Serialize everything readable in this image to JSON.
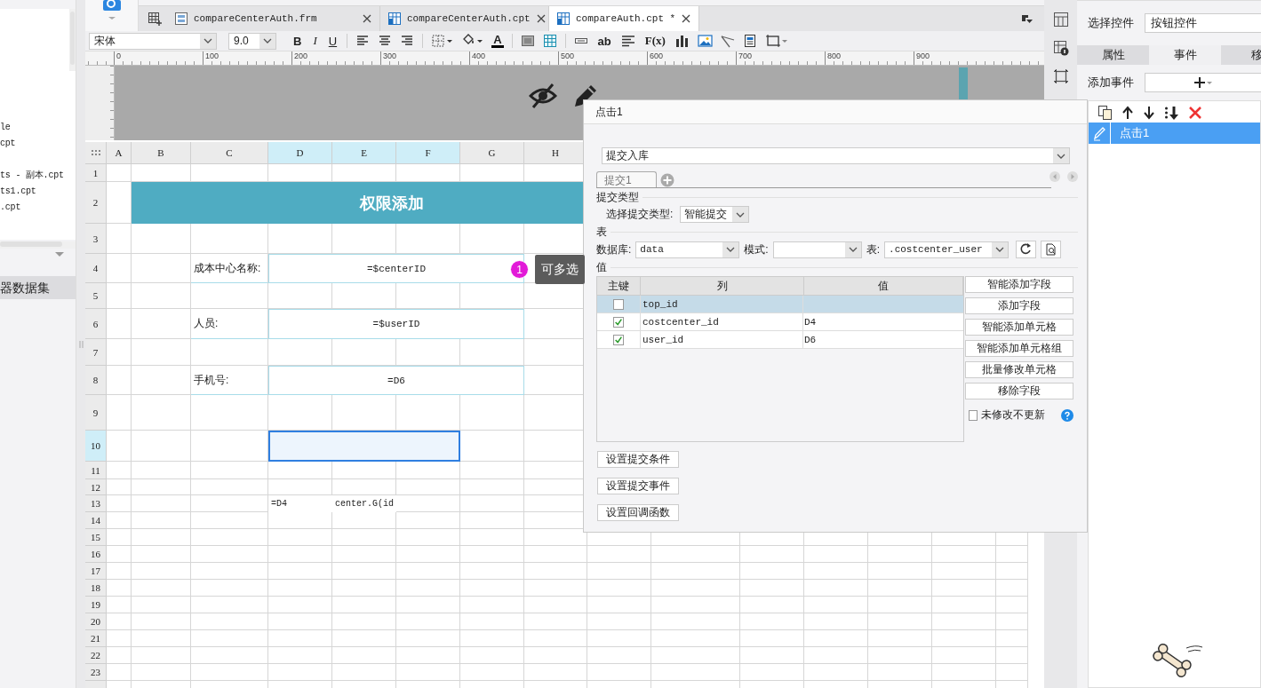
{
  "left_panel": {
    "files": [
      "le",
      "cpt",
      "ts - 副本.cpt",
      "ts1.cpt",
      ".cpt"
    ],
    "section": "器数据集"
  },
  "editor_tabs": [
    {
      "label": "compareCenterAuth.frm",
      "kind": "form",
      "selected": false
    },
    {
      "label": "compareCenterAuth.cpt",
      "kind": "report",
      "selected": false
    },
    {
      "label": "compareAuth.cpt *",
      "kind": "report",
      "selected": true
    }
  ],
  "toolbar": {
    "font": "宋体",
    "font_size": "9.0",
    "bold": "B",
    "italic": "I",
    "underline": "U",
    "font_color": "A",
    "text_tool": "ab",
    "formula": "F(x)"
  },
  "ruler": [
    "0",
    "100",
    "200",
    "300",
    "400",
    "500",
    "600",
    "700",
    "800",
    "900"
  ],
  "sheet": {
    "columns": [
      {
        "label": "A",
        "selected": false
      },
      {
        "label": "B",
        "selected": false
      },
      {
        "label": "C",
        "selected": false
      },
      {
        "label": "D",
        "selected": true
      },
      {
        "label": "E",
        "selected": true
      },
      {
        "label": "F",
        "selected": true
      },
      {
        "label": "G",
        "selected": false
      },
      {
        "label": "H",
        "selected": false
      }
    ],
    "rows": [
      {
        "label": "1",
        "selected": false
      },
      {
        "label": "2",
        "selected": false
      },
      {
        "label": "3",
        "selected": false
      },
      {
        "label": "4",
        "selected": false
      },
      {
        "label": "5",
        "selected": false
      },
      {
        "label": "6",
        "selected": false
      },
      {
        "label": "7",
        "selected": false
      },
      {
        "label": "8",
        "selected": false
      },
      {
        "label": "9",
        "selected": false
      },
      {
        "label": "10",
        "selected": true
      },
      {
        "label": "11",
        "selected": false
      },
      {
        "label": "12",
        "selected": false
      },
      {
        "label": "13",
        "selected": false
      },
      {
        "label": "14",
        "selected": false
      },
      {
        "label": "15",
        "selected": false
      },
      {
        "label": "16",
        "selected": false
      },
      {
        "label": "17",
        "selected": false
      },
      {
        "label": "18",
        "selected": false
      },
      {
        "label": "19",
        "selected": false
      },
      {
        "label": "20",
        "selected": false
      },
      {
        "label": "21",
        "selected": false
      },
      {
        "label": "22",
        "selected": false
      },
      {
        "label": "23",
        "selected": false
      }
    ],
    "cells": [
      "权限添加",
      "成本中心名称:",
      "=$centerID",
      "人员:",
      "=$userID",
      "手机号:",
      "=D6",
      "=D4",
      "center.G(id"
    ]
  },
  "tooltip": {
    "badge": "1",
    "text": "可多选"
  },
  "dialog": {
    "title": "点击1",
    "action": "提交入库",
    "tabs": [
      {
        "label": "提交1",
        "selected": true
      }
    ],
    "submit_type_heading": "提交类型",
    "submit_type_label": "选择提交类型:",
    "submit_type": "智能提交",
    "table_heading": "表",
    "database_label": "数据库:",
    "database": "data",
    "schema_label": "模式:",
    "table_label": "表:",
    "table": ".costcenter_user",
    "values_heading": "值",
    "columns": [
      "主键",
      "列",
      "值"
    ],
    "fields": [
      {
        "primary_key": false,
        "column": "top_id",
        "selected": true
      },
      {
        "primary_key": true,
        "column": "costcenter_id",
        "value": "D4",
        "selected": false
      },
      {
        "primary_key": true,
        "column": "user_id",
        "value": "D6",
        "selected": false
      }
    ],
    "side_buttons": [
      "智能添加字段",
      "添加字段",
      "智能添加单元格",
      "智能添加单元格组",
      "批量修改单元格",
      "移除字段"
    ],
    "skip_unmodified": {
      "label": "未修改不更新",
      "checked": false
    },
    "bottom_buttons": [
      "设置提交条件",
      "设置提交事件",
      "设置回调函数"
    ]
  },
  "right_panel": {
    "control_label": "选择控件",
    "control": "按钮控件",
    "tabs": [
      {
        "label": "属性",
        "selected": false
      },
      {
        "label": "事件",
        "selected": true
      },
      {
        "label": "移",
        "selected": false
      }
    ],
    "add_event_label": "添加事件",
    "events": [
      {
        "label": "点击1",
        "selected": true
      }
    ]
  }
}
